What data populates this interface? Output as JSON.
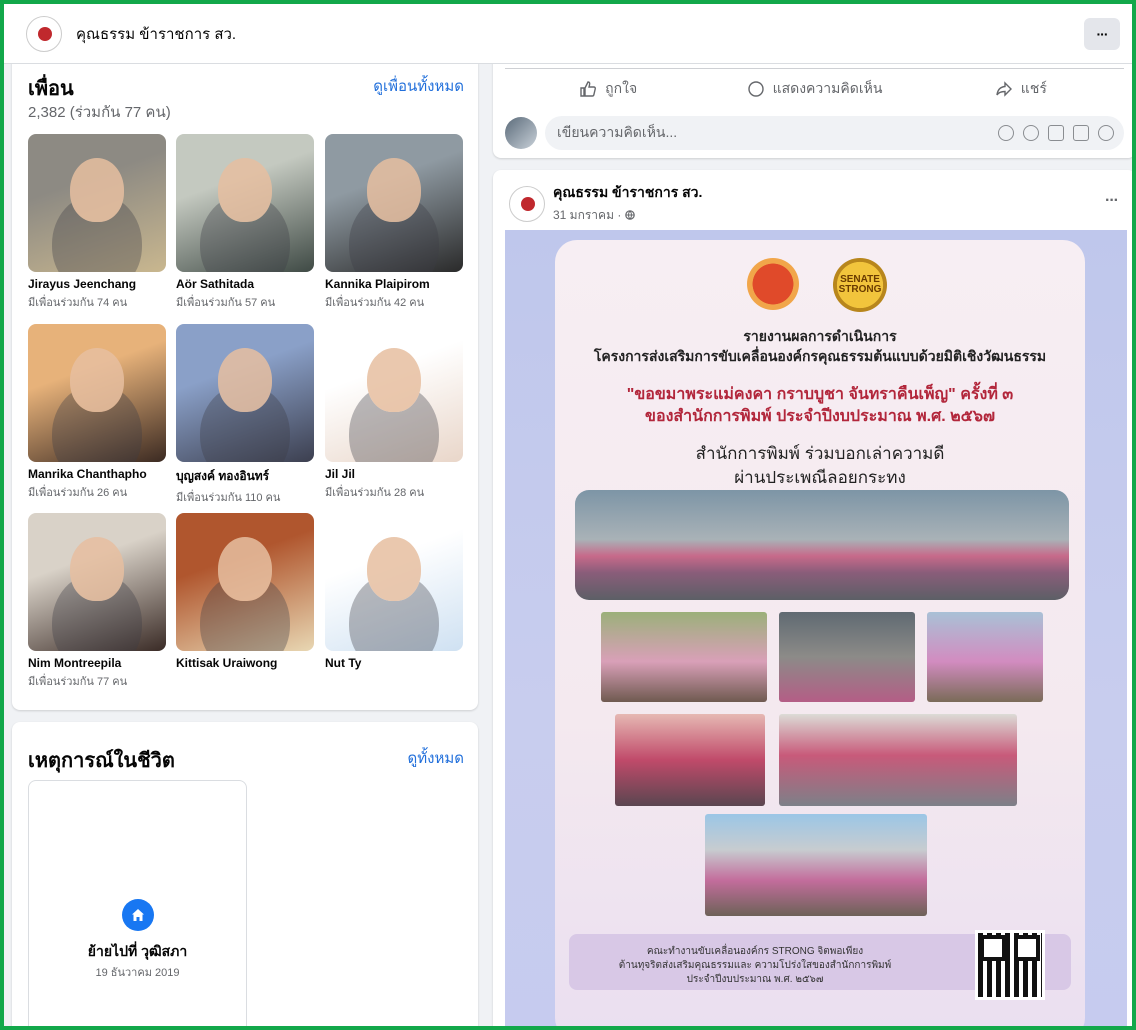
{
  "header": {
    "page_name": "คุณธรรม ข้าราชการ สว.",
    "more_label": "···"
  },
  "friends": {
    "title": "เพื่อน",
    "see_all": "ดูเพื่อนทั้งหมด",
    "count_text": "2,382 (ร่วมกัน 77 คน)",
    "items": [
      {
        "name": "Jirayus Jeenchang",
        "mutual": "มีเพื่อนร่วมกัน 74 คน",
        "colors": [
          "#8d8a83",
          "#c9b78f"
        ]
      },
      {
        "name": "Aör Sathitada",
        "mutual": "มีเพื่อนร่วมกัน 57 คน",
        "colors": [
          "#c4c9c0",
          "#3f4a45"
        ]
      },
      {
        "name": "Kannika Plaipirom",
        "mutual": "มีเพื่อนร่วมกัน 42 คน",
        "colors": [
          "#8f9aa2",
          "#2a2a2a"
        ]
      },
      {
        "name": "Manrika Chanthapho",
        "mutual": "มีเพื่อนร่วมกัน 26 คน",
        "colors": [
          "#e7b27a",
          "#3b2a22"
        ]
      },
      {
        "name": "บุญสงค์ ทองอินทร์",
        "mutual": "มีเพื่อนร่วมกัน 110 คน",
        "colors": [
          "#8aa0c8",
          "#3c3f4f"
        ]
      },
      {
        "name": "Jil Jil",
        "mutual": "มีเพื่อนร่วมกัน 28 คน",
        "colors": [
          "#ffffff",
          "#e9d6c9"
        ]
      },
      {
        "name": "Nim Montreepila",
        "mutual": "มีเพื่อนร่วมกัน 77 คน",
        "colors": [
          "#d9d2c8",
          "#3a2b26"
        ]
      },
      {
        "name": "Kittisak Uraiwong",
        "mutual": "",
        "colors": [
          "#b0562e",
          "#e8d7b3"
        ]
      },
      {
        "name": "Nut Ty",
        "mutual": "",
        "colors": [
          "#ffffff",
          "#cfe1f2"
        ]
      }
    ]
  },
  "life_events": {
    "title": "เหตุการณ์ในชีวิต",
    "see_all": "ดูทั้งหมด",
    "event_title": "ย้ายไปที่ วุฒิสภา",
    "event_date": "19 ธันวาคม 2019"
  },
  "post_actions": {
    "like": "ถูกใจ",
    "comment": "แสดงความคิดเห็น",
    "share": "แชร์",
    "comment_placeholder": "เขียนความคิดเห็น..."
  },
  "post": {
    "author": "คุณธรรม ข้าราชการ สว.",
    "date": "31 มกราคม · ",
    "more": "···",
    "poster": {
      "logo_text": "SENATE STRONG",
      "line1": "รายงานผลการดำเนินการ",
      "line2": "โครงการส่งเสริมการขับเคลื่อนองค์กรคุณธรรมต้นแบบด้วยมิติเชิงวัฒนธรรม",
      "line3": "\"ขอขมาพระแม่คงคา กราบบูชา จันทราคืนเพ็ญ\" ครั้งที่ ๓",
      "line4": "ของสำนักการพิมพ์ ประจำปีงบประมาณ พ.ศ. ๒๕๖๗",
      "line5": "สำนักการพิมพ์ ร่วมบอกเล่าความดี",
      "line6": "ผ่านประเพณีลอยกระทง",
      "footer1": "คณะทำงานขับเคลื่อนองค์กร STRONG จิตพอเพียง",
      "footer2": "ต้านทุจริตส่งเสริมคุณธรรมและ ความโปร่งใสของสำนักการพิมพ์",
      "footer3": "ประจำปีงบประมาณ พ.ศ. ๒๕๖๗"
    }
  },
  "colors": {
    "accent": "#1877f2",
    "link": "#216fdb",
    "frame": "#12a84a"
  }
}
